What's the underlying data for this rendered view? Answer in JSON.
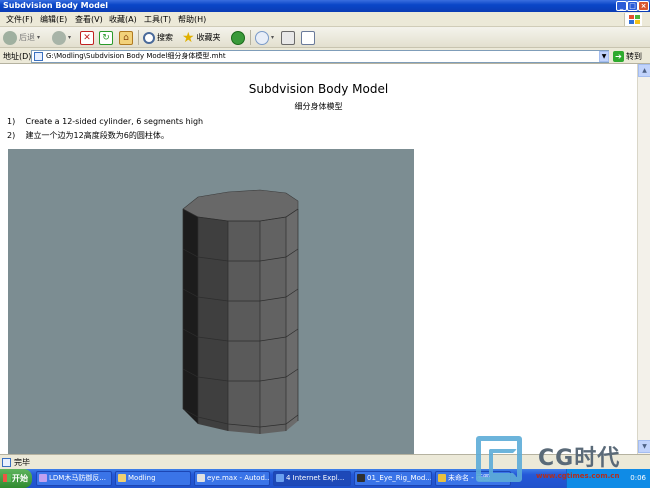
{
  "window": {
    "title": "Subdvision Body Model"
  },
  "menu": {
    "items": [
      "文件(F)",
      "编辑(E)",
      "查看(V)",
      "收藏(A)",
      "工具(T)",
      "帮助(H)"
    ]
  },
  "toolbar": {
    "back_label": "后退",
    "search_label": "搜索",
    "favorites_label": "收藏夹"
  },
  "address": {
    "label": "地址(D)",
    "value": "G:\\Modling\\Subdvision Body Model细分身体模型.mht",
    "go_label": "转到"
  },
  "page": {
    "title": "Subdvision Body Model",
    "subtitle": "细分身体模型",
    "steps": [
      {
        "num": "1)",
        "text": "Create a 12-sided cylinder, 6 segments high"
      },
      {
        "num": "2)",
        "text": "建立一个边为12高度段数为6的圆柱体。"
      }
    ]
  },
  "status": {
    "text": "完毕"
  },
  "taskbar": {
    "start_label": "开始",
    "tasks": [
      "LDM木马防御反...",
      "Modling",
      "eye.max - Autod...",
      "4 Internet Expl...",
      "01_Eye_Rig_Mod...",
      "未命名 - 画图"
    ],
    "clock": "0:06"
  },
  "watermark": {
    "title": "CG时代",
    "url": "www.cgtimes.com.cn"
  },
  "colors": {
    "titlebar": "#0a46c8",
    "viewport_bg": "#7c8d92",
    "cylinder_face": "#6b6b6b",
    "taskbar": "#2458d8"
  }
}
